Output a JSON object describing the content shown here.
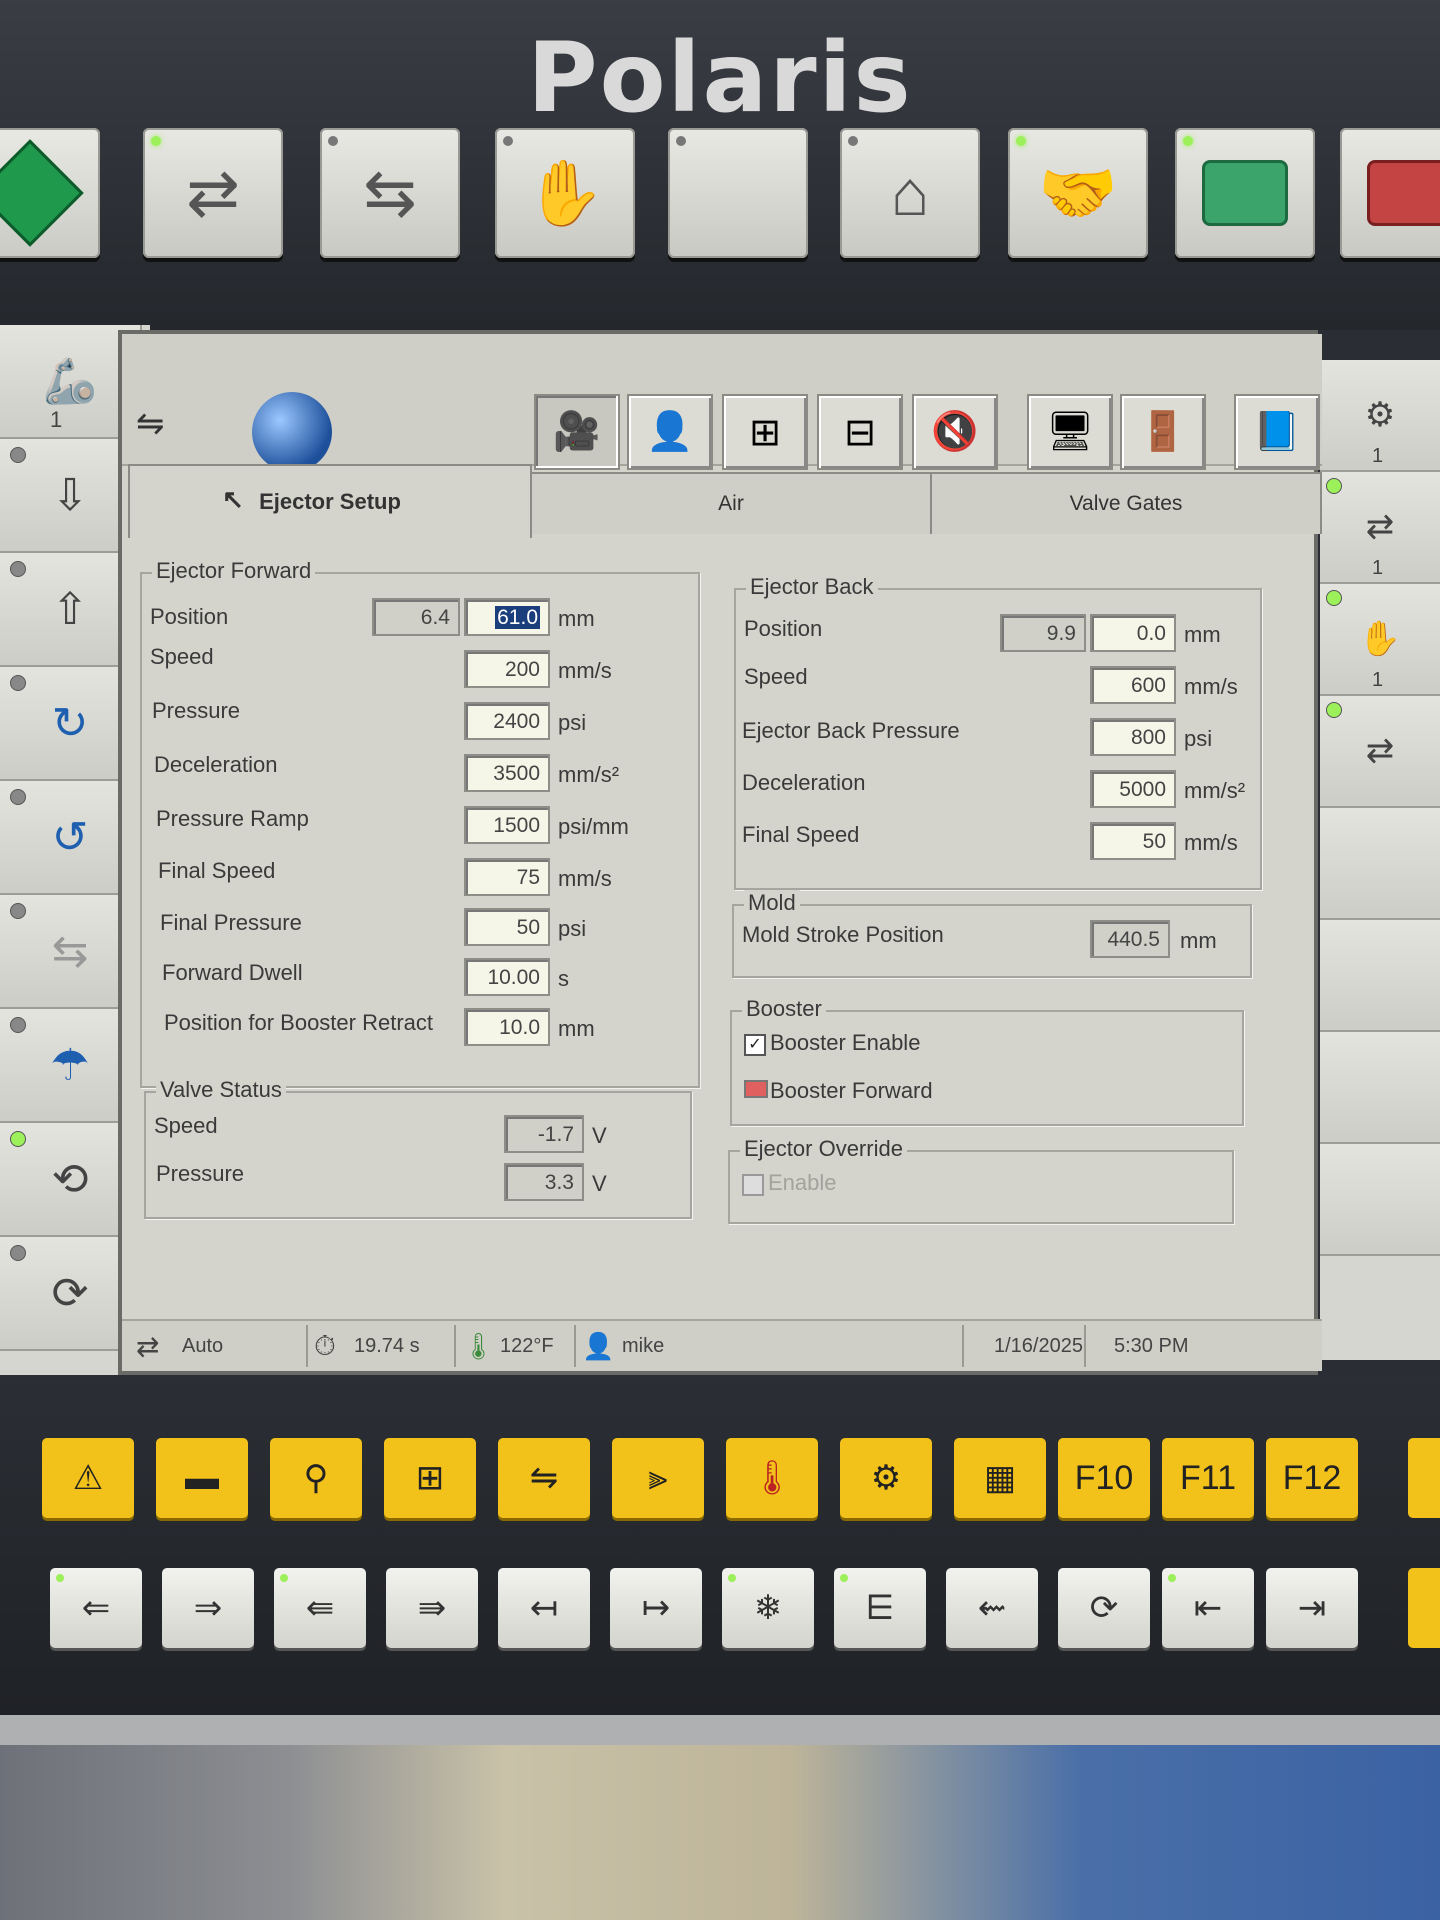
{
  "brand": "Polaris",
  "top_keys": [
    {
      "icon": "cycle-start-diamond-icon",
      "led": false
    },
    {
      "icon": "auto-cycle-icon",
      "led": true
    },
    {
      "icon": "semi-auto-cycle-icon",
      "led": false
    },
    {
      "icon": "manual-hand-icon",
      "led": false
    },
    {
      "icon": "blank-key",
      "led": false
    },
    {
      "icon": "home-robot-icon",
      "led": false
    },
    {
      "icon": "robot-handshake-icon",
      "led": true
    },
    {
      "icon": "motor-start-icon",
      "led": true
    },
    {
      "icon": "motor-stop-icon",
      "led": false
    }
  ],
  "left_keys": [
    {
      "icon": "robot-arm-icon",
      "label": "1",
      "led": false
    },
    {
      "icon": "ejector-back-icon",
      "label": "",
      "led": false
    },
    {
      "icon": "ejector-forward-icon",
      "label": "",
      "led": false
    },
    {
      "icon": "core-in-icon",
      "label": "",
      "led": false
    },
    {
      "icon": "core-out-icon",
      "label": "",
      "led": false
    },
    {
      "icon": "ejector-retract-icon",
      "label": "",
      "led": false
    },
    {
      "icon": "air-blow-icon",
      "label": "",
      "led": false
    },
    {
      "icon": "conveyor-back-icon",
      "label": "",
      "led": true
    },
    {
      "icon": "conveyor-forward-icon",
      "label": "",
      "led": false
    }
  ],
  "right_keys": [
    {
      "icon": "robot-mold-icon",
      "label": "1"
    },
    {
      "icon": "valve-gate-icon",
      "label": "1"
    },
    {
      "icon": "hand-spray-icon",
      "label": "1"
    },
    {
      "icon": "robot-eject-icon",
      "label": ""
    }
  ],
  "toolbar_icons": [
    "mold-setup-icon",
    "globe-icon",
    "camera-operator-icon",
    "operator-icon",
    "clamp-measure-icon",
    "clamp-icon",
    "sound-off-icon",
    "monitor-icon",
    "exit-door-icon",
    "help-book-icon"
  ],
  "tabs": {
    "ejector_setup": "Ejector Setup",
    "air": "Air",
    "valve_gates": "Valve Gates"
  },
  "ejector_forward": {
    "title": "Ejector Forward",
    "position": {
      "label": "Position",
      "actual": "6.4",
      "value": "61.0",
      "unit": "mm"
    },
    "speed": {
      "label": "Speed",
      "value": "200",
      "unit": "mm/s"
    },
    "pressure": {
      "label": "Pressure",
      "value": "2400",
      "unit": "psi"
    },
    "deceleration": {
      "label": "Deceleration",
      "value": "3500",
      "unit": "mm/s²"
    },
    "pressure_ramp": {
      "label": "Pressure Ramp",
      "value": "1500",
      "unit": "psi/mm"
    },
    "final_speed": {
      "label": "Final Speed",
      "value": "75",
      "unit": "mm/s"
    },
    "final_pressure": {
      "label": "Final Pressure",
      "value": "50",
      "unit": "psi"
    },
    "forward_dwell": {
      "label": "Forward Dwell",
      "value": "10.00",
      "unit": "s"
    },
    "booster_retract": {
      "label": "Position for Booster Retract",
      "value": "10.0",
      "unit": "mm"
    }
  },
  "valve_status": {
    "title": "Valve Status",
    "speed": {
      "label": "Speed",
      "value": "-1.7",
      "unit": "V"
    },
    "pressure": {
      "label": "Pressure",
      "value": "3.3",
      "unit": "V"
    }
  },
  "ejector_back": {
    "title": "Ejector Back",
    "position": {
      "label": "Position",
      "actual": "9.9",
      "value": "0.0",
      "unit": "mm"
    },
    "speed": {
      "label": "Speed",
      "value": "600",
      "unit": "mm/s"
    },
    "back_pressure": {
      "label": "Ejector Back Pressure",
      "value": "800",
      "unit": "psi"
    },
    "deceleration": {
      "label": "Deceleration",
      "value": "5000",
      "unit": "mm/s²"
    },
    "final_speed": {
      "label": "Final Speed",
      "value": "50",
      "unit": "mm/s"
    }
  },
  "mold": {
    "title": "Mold",
    "stroke": {
      "label": "Mold Stroke Position",
      "value": "440.5",
      "unit": "mm"
    }
  },
  "booster": {
    "title": "Booster",
    "enable_label": "Booster Enable",
    "enable_checked": true,
    "forward_label": "Booster Forward",
    "forward_indicator_color": "#e06060"
  },
  "ejector_override": {
    "title": "Ejector Override",
    "enable_label": "Enable",
    "enabled": false
  },
  "status_bar": {
    "mode": "Auto",
    "cycle_time": "19.74 s",
    "temperature": "122°F",
    "user": "mike",
    "date": "1/16/2025",
    "time": "5:30 PM"
  },
  "function_keys": [
    {
      "icon": "alarm-warning-icon",
      "label": ""
    },
    {
      "icon": "injection-unit-icon",
      "label": ""
    },
    {
      "icon": "robot-gripper-icon",
      "label": ""
    },
    {
      "icon": "mold-icon",
      "label": ""
    },
    {
      "icon": "ejector-icon",
      "label": ""
    },
    {
      "icon": "nozzle-screw-icon",
      "label": ""
    },
    {
      "icon": "heater-temp-icon",
      "label": ""
    },
    {
      "icon": "robot-arm-key-icon",
      "label": ""
    },
    {
      "icon": "graph-trend-icon",
      "label": ""
    },
    {
      "icon": "",
      "label": "F10"
    },
    {
      "icon": "",
      "label": "F11"
    },
    {
      "icon": "",
      "label": "F12"
    }
  ],
  "manual_keys": [
    {
      "icon": "mold-open-icon",
      "led": true
    },
    {
      "icon": "mold-close-icon",
      "led": false
    },
    {
      "icon": "carriage-back-icon",
      "led": true
    },
    {
      "icon": "carriage-forward-icon",
      "led": false
    },
    {
      "icon": "ejector-back-key-icon",
      "led": false
    },
    {
      "icon": "ejector-forward-key-icon",
      "led": false
    },
    {
      "icon": "snowflake-cooling-icon",
      "led": true
    },
    {
      "icon": "nozzle-purge-icon",
      "led": true
    },
    {
      "icon": "screw-decompress-icon",
      "led": false
    },
    {
      "icon": "screw-rotate-icon",
      "led": false
    },
    {
      "icon": "core-back-key-icon",
      "led": true
    },
    {
      "icon": "core-forward-key-icon",
      "led": false
    }
  ]
}
